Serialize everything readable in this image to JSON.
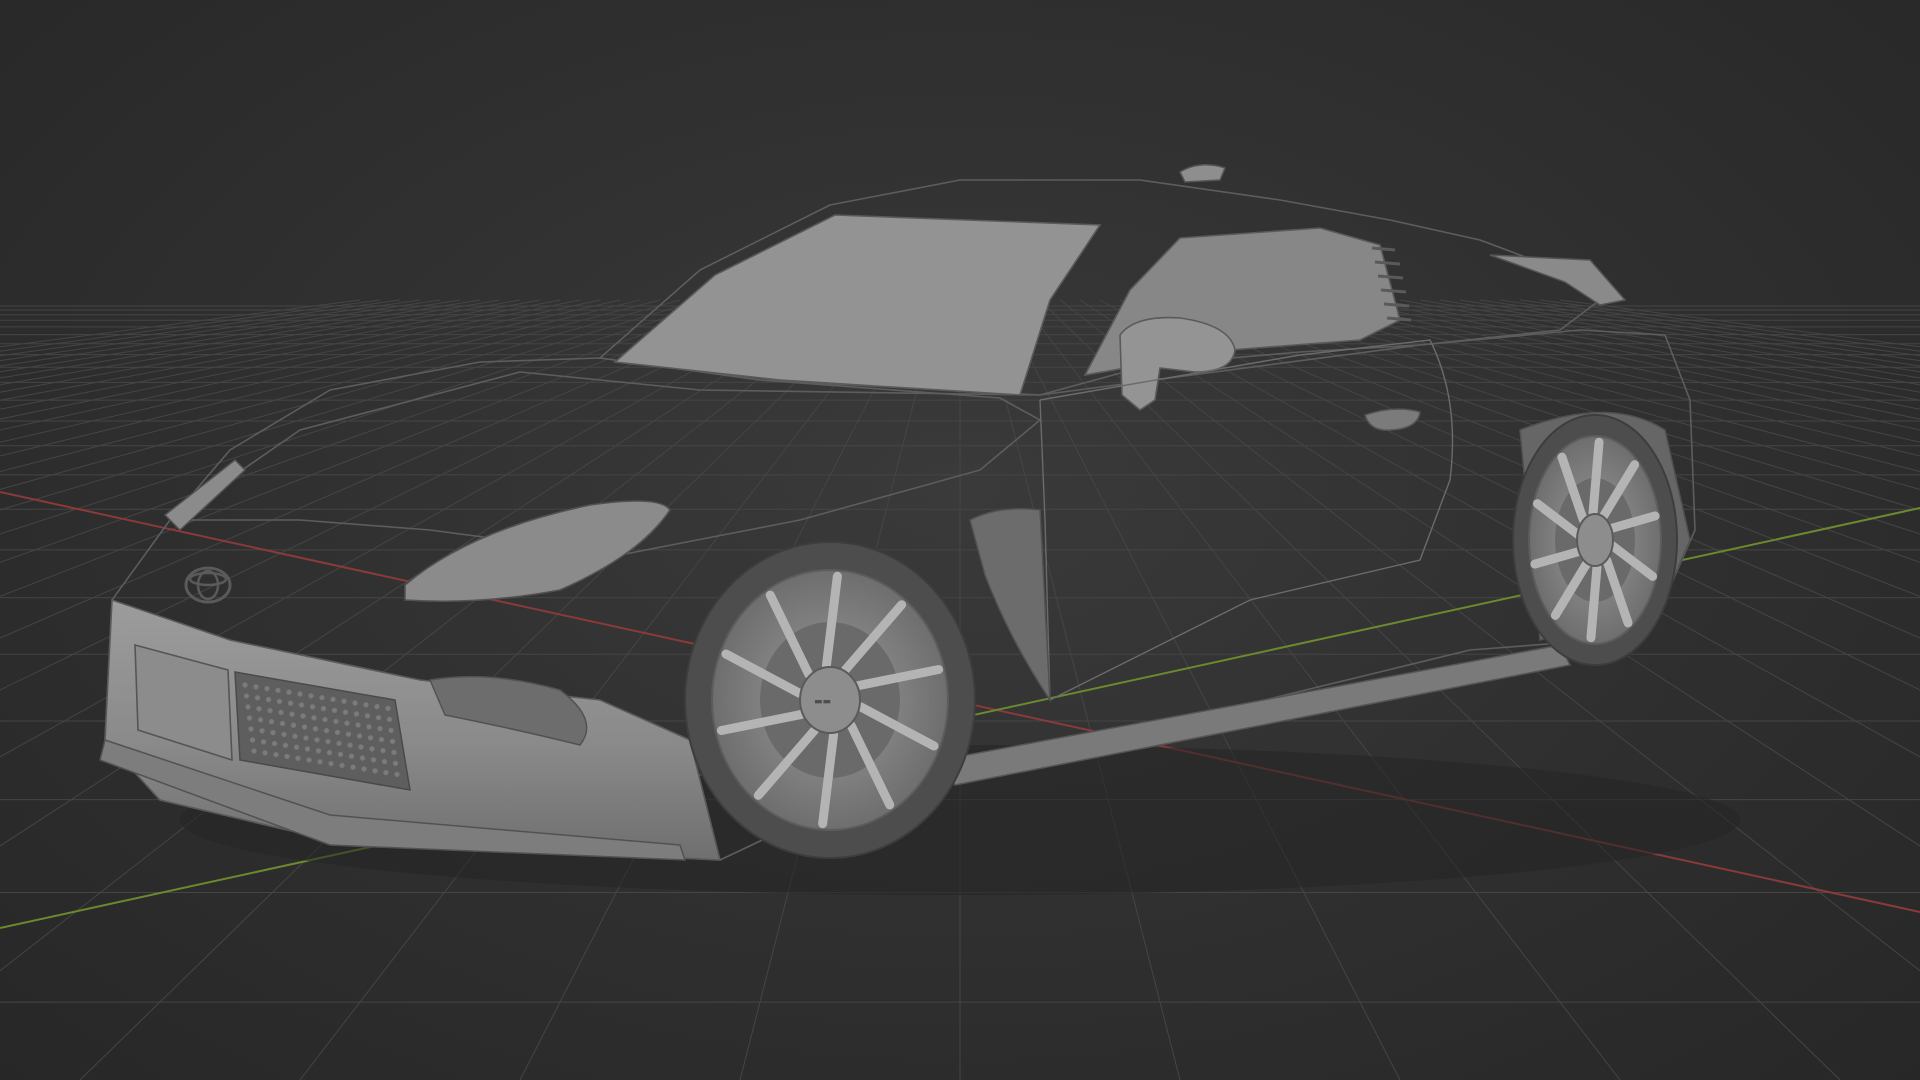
{
  "viewport": {
    "background_color": "#2f2f2f",
    "grid_color": "#454545",
    "x_axis_color": "#8a3a3a",
    "y_axis_color": "#6a8a2e",
    "clay_color": "#8f8f8f"
  },
  "scene": {
    "object": "car-model",
    "shading": "solid-clay",
    "wheel_spokes": 10
  }
}
